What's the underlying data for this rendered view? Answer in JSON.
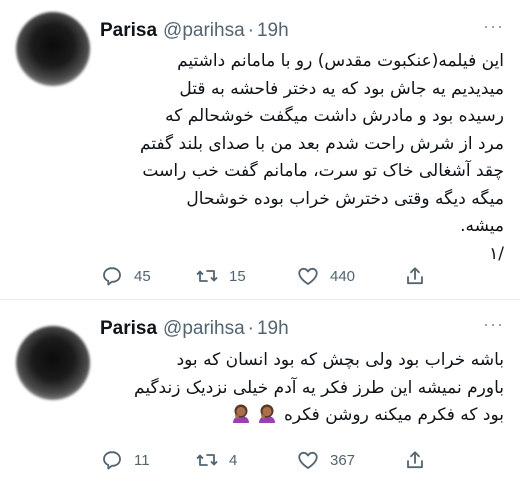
{
  "tweets": [
    {
      "user": {
        "name": "Parisa",
        "handle": "@parihsa",
        "time": "19h"
      },
      "more": "···",
      "lines": [
        "این فیلمه(عنکبوت مقدس) رو با مامانم داشتیم",
        "میدیدیم  یه جاش بود که یه دختر فاحشه به قتل",
        "رسیده بود و مادرش داشت میگفت خوشحالم که",
        "مرد از شرش راحت شدم بعد من با صدای بلند گفتم",
        "چقد آشغالی خاک تو سرت، مامانم گفت خب راست",
        "میگه دیگه وقتی دخترش خراب بوده خوشحال",
        "میشه.",
        "/۱"
      ],
      "stats": {
        "replies": "45",
        "retweets": "15",
        "likes": "440"
      }
    },
    {
      "user": {
        "name": "Parisa",
        "handle": "@parihsa",
        "time": "19h"
      },
      "more": "···",
      "lines": [
        "باشه خراب بود ولی بچش که بود انسان که بود",
        "باورم نمیشه این طرز فکر یه آدم خیلی نزدیک زندگیم",
        "بود که فکرم میکنه روشن فکره"
      ],
      "emoji": "woman-facepalming-emoji",
      "stats": {
        "replies": "11",
        "retweets": "4",
        "likes": "367"
      }
    }
  ],
  "colors": {
    "text": "#0f1419",
    "muted": "#536471",
    "divider": "#e6ecf0"
  }
}
